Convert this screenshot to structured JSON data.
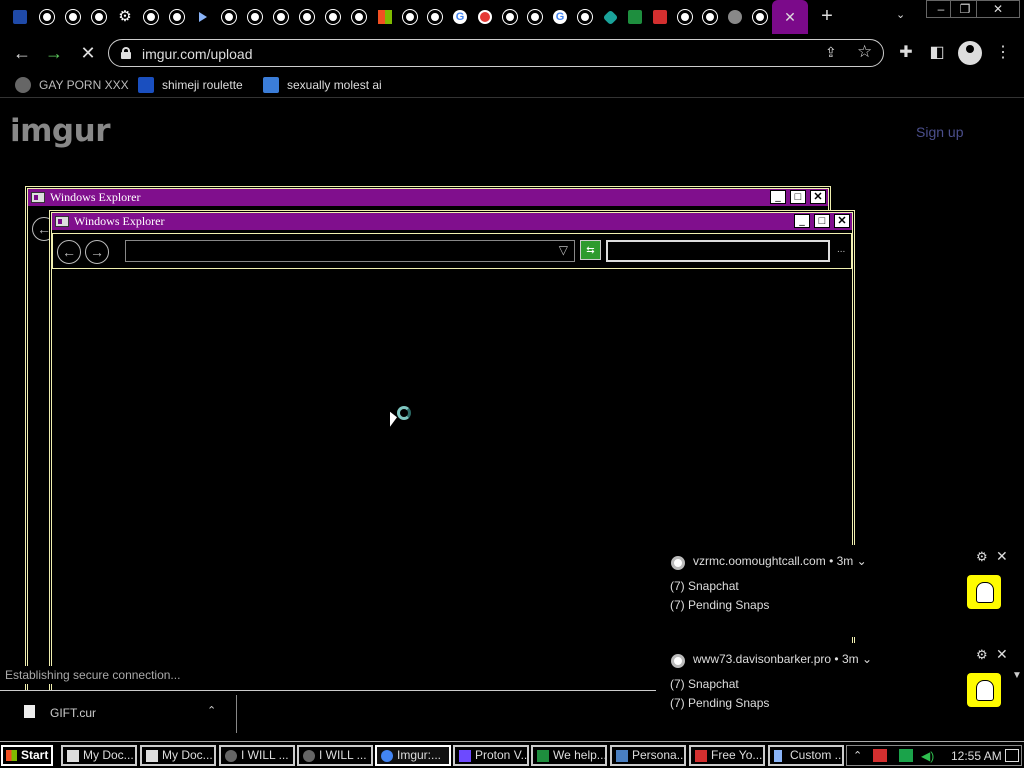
{
  "browser": {
    "active_tab_close": "✕",
    "new_tab": "+",
    "tab_search": "⌄",
    "window_controls": {
      "minimize": "–",
      "restore": "❐",
      "close": "✕"
    },
    "url": "imgur.com/upload",
    "nav": {
      "back": "←",
      "forward": "→",
      "stop": "✕"
    },
    "bookmarks": [
      {
        "label": "GAY PORN XXX"
      },
      {
        "label": "shimeji roulette"
      },
      {
        "label": "sexually molest ai"
      }
    ]
  },
  "page": {
    "logo": "imgur",
    "signup": "Sign up",
    "status": "Establishing secure connection..."
  },
  "explorer": {
    "back_window_title": "Windows Explorer",
    "front_window_title": "Windows Explorer",
    "buttons": {
      "min": "_",
      "max": "□",
      "close": "✕"
    },
    "back": "←",
    "forward": "→",
    "dropdown": "▽",
    "go": "⇆",
    "more": "..."
  },
  "download": {
    "file_name": "GIFT.cur",
    "chevron": "⌃"
  },
  "notifications": [
    {
      "source": "vzrmc.oomoughtcall.com",
      "time": "• 3m ⌄",
      "title": "(7) Snapchat",
      "body": "(7) Pending Snaps"
    },
    {
      "source": "www73.davisonbarker.pro",
      "time": "• 3m ⌄",
      "title": "(7) Snapchat",
      "body": "(7) Pending Snaps"
    }
  ],
  "taskbar": {
    "start": "Start",
    "tasks": [
      {
        "label": "My Doc..."
      },
      {
        "label": "My Doc..."
      },
      {
        "label": "I WILL ..."
      },
      {
        "label": "I WILL ..."
      },
      {
        "label": "Imgur:..."
      },
      {
        "label": "Proton V..."
      },
      {
        "label": "We help..."
      },
      {
        "label": "Persona..."
      },
      {
        "label": "Free Yo..."
      },
      {
        "label": "Custom ..."
      }
    ],
    "clock": "12:55 AM"
  }
}
